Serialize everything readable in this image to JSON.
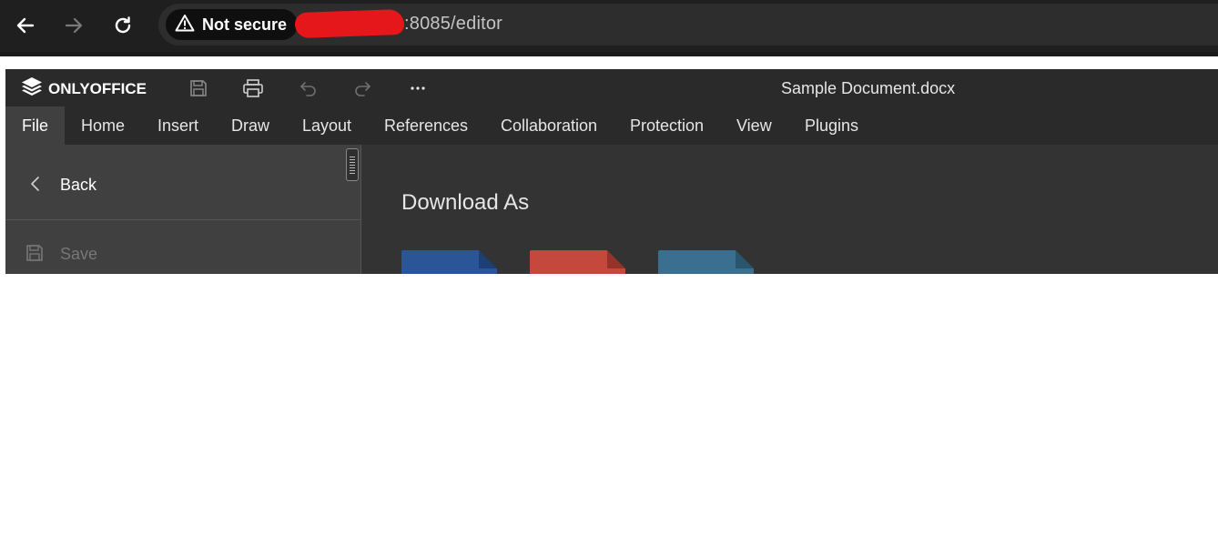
{
  "browser": {
    "security_label": "Not secure",
    "url_visible": ":8085/editor"
  },
  "editor": {
    "brand": "ONLYOFFICE",
    "document_title": "Sample Document.docx",
    "tabs": [
      {
        "label": "File",
        "active": true
      },
      {
        "label": "Home"
      },
      {
        "label": "Insert"
      },
      {
        "label": "Draw"
      },
      {
        "label": "Layout"
      },
      {
        "label": "References"
      },
      {
        "label": "Collaboration"
      },
      {
        "label": "Protection"
      },
      {
        "label": "View"
      },
      {
        "label": "Plugins"
      }
    ],
    "sidebar": {
      "back_label": "Back",
      "save_label": "Save"
    },
    "content": {
      "heading": "Download As",
      "formats": [
        {
          "icon": "docx-file-icon",
          "color": "#2a5597"
        },
        {
          "icon": "pdf-file-icon",
          "color": "#c4483b"
        },
        {
          "icon": "odt-file-icon",
          "color": "#3a6f8f"
        }
      ]
    }
  },
  "colors": {
    "browser_bg": "#1f1f1f",
    "editor_bg": "#2a2a2a",
    "active_tab": "#404040",
    "redaction": "#e5171a"
  }
}
